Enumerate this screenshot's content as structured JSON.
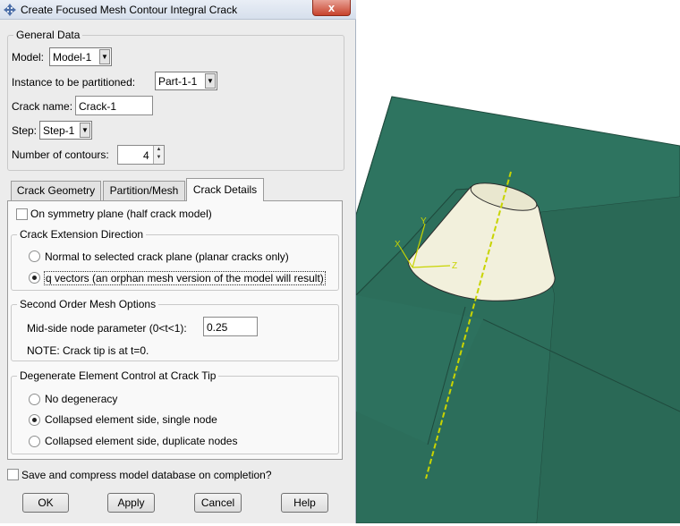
{
  "window": {
    "title": "Create Focused Mesh Contour Integral Crack",
    "close_label": "x"
  },
  "general": {
    "group_title": "General Data",
    "model_label": "Model:",
    "model_value": "Model-1",
    "instance_label": "Instance to be partitioned:",
    "instance_value": "Part-1-1",
    "crack_name_label": "Crack name:",
    "crack_name_value": "Crack-1",
    "step_label": "Step:",
    "step_value": "Step-1",
    "contours_label": "Number of contours:",
    "contours_value": "4"
  },
  "tabs": [
    {
      "label": "Crack Geometry"
    },
    {
      "label": "Partition/Mesh"
    },
    {
      "label": "Crack Details"
    }
  ],
  "details": {
    "symmetry_label": "On symmetry plane (half crack model)",
    "extension": {
      "title": "Crack Extension Direction",
      "option1": "Normal to selected crack plane (planar cracks only)",
      "option2": "q vectors (an orphan mesh version of the model will result)"
    },
    "second_order": {
      "title": "Second Order Mesh Options",
      "midside_label": "Mid-side node parameter (0<t<1):",
      "midside_value": "0.25",
      "note": "NOTE: Crack tip is at t=0."
    },
    "degenerate": {
      "title": "Degenerate Element Control at Crack Tip",
      "option1": "No degeneracy",
      "option2": "Collapsed element side, single node",
      "option3": "Collapsed element side, duplicate nodes"
    }
  },
  "save_label": "Save and compress model database on completion?",
  "buttons": {
    "ok": "OK",
    "apply": "Apply",
    "cancel": "Cancel",
    "help": "Help"
  },
  "viewport": {
    "triad": {
      "x": "X",
      "y": "Y",
      "z": "Z"
    },
    "colors": {
      "solid": "#2f735d",
      "solid_dark": "#275f4d",
      "cone": "#f2f0dc",
      "axis": "#c8d400"
    }
  }
}
